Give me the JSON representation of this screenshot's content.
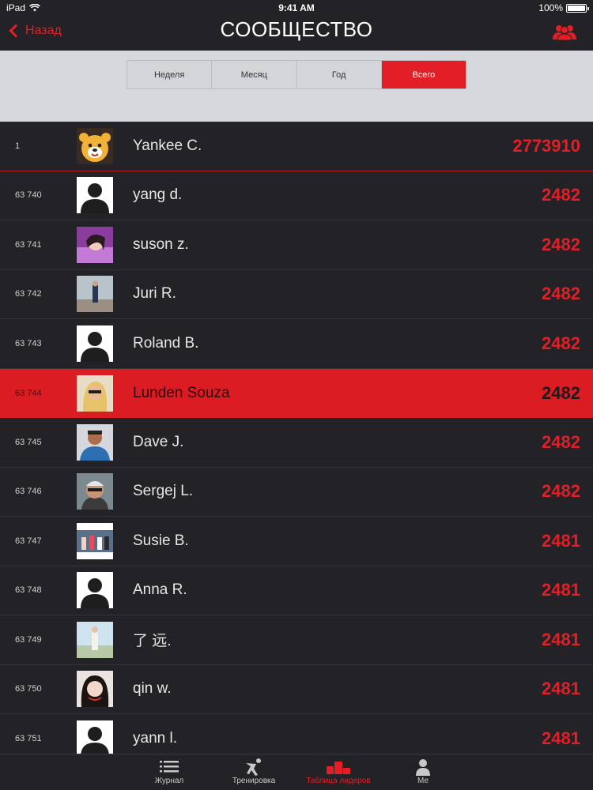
{
  "status_bar": {
    "device": "iPad",
    "time": "9:41 AM",
    "battery": "100%"
  },
  "nav": {
    "back_label": "Назад",
    "title": "СООБЩЕСТВО",
    "right_icon": "community-icon"
  },
  "segments": [
    {
      "label": "Неделя",
      "active": false
    },
    {
      "label": "Месяц",
      "active": false
    },
    {
      "label": "Год",
      "active": false
    },
    {
      "label": "Всего",
      "active": true
    }
  ],
  "leaderboard": [
    {
      "rank": "1",
      "name": "Yankee C.",
      "score": "2773910",
      "avatar": "bear-avatar"
    },
    {
      "rank": "63 740",
      "name": "yang d.",
      "score": "2482",
      "avatar": "default-avatar"
    },
    {
      "rank": "63 741",
      "name": "suson z.",
      "score": "2482",
      "avatar": "photo-avatar"
    },
    {
      "rank": "63 742",
      "name": "Juri R.",
      "score": "2482",
      "avatar": "photo-avatar"
    },
    {
      "rank": "63 743",
      "name": "Roland B.",
      "score": "2482",
      "avatar": "default-avatar"
    },
    {
      "rank": "63 744",
      "name": "Lunden Souza",
      "score": "2482",
      "avatar": "photo-avatar",
      "current_user": true
    },
    {
      "rank": "63 745",
      "name": "Dave J.",
      "score": "2482",
      "avatar": "photo-avatar"
    },
    {
      "rank": "63 746",
      "name": "Sergej L.",
      "score": "2482",
      "avatar": "photo-avatar"
    },
    {
      "rank": "63 747",
      "name": "Susie B.",
      "score": "2481",
      "avatar": "photo-avatar"
    },
    {
      "rank": "63 748",
      "name": "Anna R.",
      "score": "2481",
      "avatar": "default-avatar"
    },
    {
      "rank": "63 749",
      "name": "了 远.",
      "score": "2481",
      "avatar": "photo-avatar"
    },
    {
      "rank": "63 750",
      "name": "qin w.",
      "score": "2481",
      "avatar": "photo-avatar"
    },
    {
      "rank": "63 751",
      "name": "yann l.",
      "score": "2481",
      "avatar": "default-avatar"
    }
  ],
  "tabs": [
    {
      "label": "Журнал",
      "icon": "list-icon",
      "active": false
    },
    {
      "label": "Тренировка",
      "icon": "workout-icon",
      "active": false
    },
    {
      "label": "Таблица лидеров",
      "icon": "podium-icon",
      "active": true
    },
    {
      "label": "Me",
      "icon": "profile-icon",
      "active": false
    }
  ],
  "colors": {
    "accent": "#e21f26",
    "background": "#232226",
    "segment_bg": "#d6d8dc"
  }
}
